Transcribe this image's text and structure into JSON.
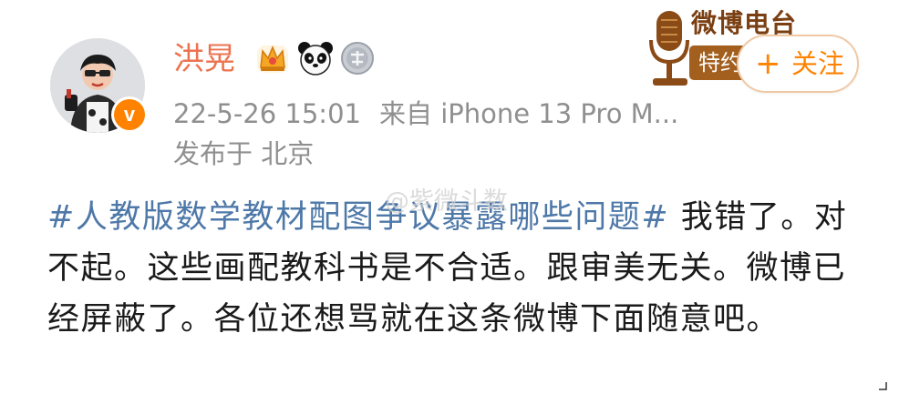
{
  "post": {
    "username": "洪晃",
    "date": "22-5-26 15:01",
    "source": "来自 iPhone 13 Pro M...",
    "location": "发布于 北京",
    "follow_label": "关注",
    "follow_plus": "+",
    "topic": "#人教版数学教材配图争议暴露哪些问题#",
    "text": " 我错了。对不起。这些画配教科书是不合适。跟审美无关。微博已经屏蔽了。各位还想骂就在这条微博下面随意吧。",
    "verified_mark": "v"
  },
  "badge": {
    "title": "微博电台",
    "ribbon": "特约"
  },
  "icons": {
    "crown": "crown-icon",
    "panda": "panda-icon",
    "medal": "medal-icon",
    "microphone": "microphone-icon",
    "verified": "verified-badge-icon"
  },
  "colors": {
    "username": "#eb7350",
    "follow": "#ff8200",
    "topic": "#4e78a8",
    "meta": "#8f8f8f",
    "text": "#1a1a1a"
  },
  "watermark": "@紫微斗数"
}
